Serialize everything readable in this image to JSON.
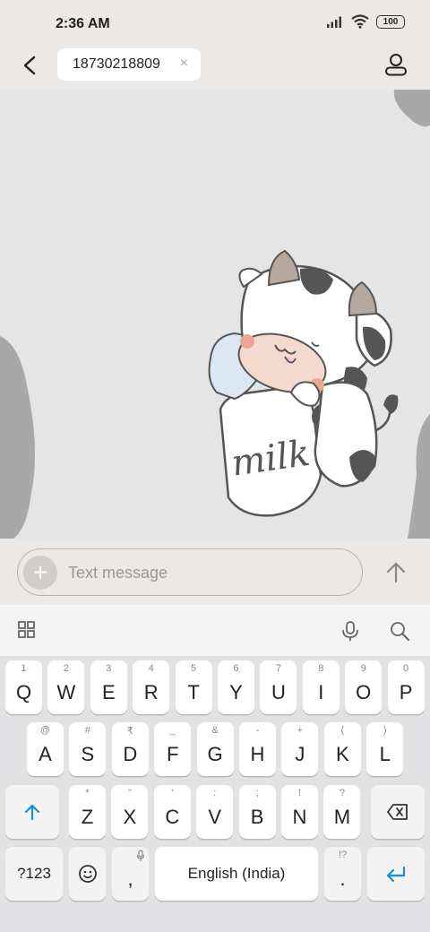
{
  "status_bar": {
    "time": "2:36 AM",
    "battery": "100"
  },
  "header": {
    "recipient": "18730218809",
    "chip_close": "×"
  },
  "compose": {
    "placeholder": "Text message",
    "add_symbol": "+"
  },
  "keyboard": {
    "row1": [
      {
        "hint": "1",
        "label": "Q"
      },
      {
        "hint": "2",
        "label": "W"
      },
      {
        "hint": "3",
        "label": "E"
      },
      {
        "hint": "4",
        "label": "R"
      },
      {
        "hint": "5",
        "label": "T"
      },
      {
        "hint": "6",
        "label": "Y"
      },
      {
        "hint": "7",
        "label": "U"
      },
      {
        "hint": "8",
        "label": "I"
      },
      {
        "hint": "9",
        "label": "O"
      },
      {
        "hint": "0",
        "label": "P"
      }
    ],
    "row2": [
      {
        "hint": "@",
        "label": "A"
      },
      {
        "hint": "#",
        "label": "S"
      },
      {
        "hint": "₹",
        "label": "D"
      },
      {
        "hint": "_",
        "label": "F"
      },
      {
        "hint": "&",
        "label": "G"
      },
      {
        "hint": "-",
        "label": "H"
      },
      {
        "hint": "+",
        "label": "J"
      },
      {
        "hint": "(",
        "label": "K"
      },
      {
        "hint": ")",
        "label": "L"
      }
    ],
    "row3": [
      {
        "hint": "*",
        "label": "Z"
      },
      {
        "hint": "\"",
        "label": "X"
      },
      {
        "hint": "'",
        "label": "C"
      },
      {
        "hint": ":",
        "label": "V"
      },
      {
        "hint": ";",
        "label": "B"
      },
      {
        "hint": "!",
        "label": "N"
      },
      {
        "hint": "?",
        "label": "M"
      }
    ],
    "symbols_label": "?123",
    "comma": ",",
    "space_label": "English (India)",
    "period_hint": "!?",
    "period": "."
  },
  "colors": {
    "accent": "#1a8fd6",
    "background": "#e6e5e5",
    "bar": "#ece8e6"
  }
}
